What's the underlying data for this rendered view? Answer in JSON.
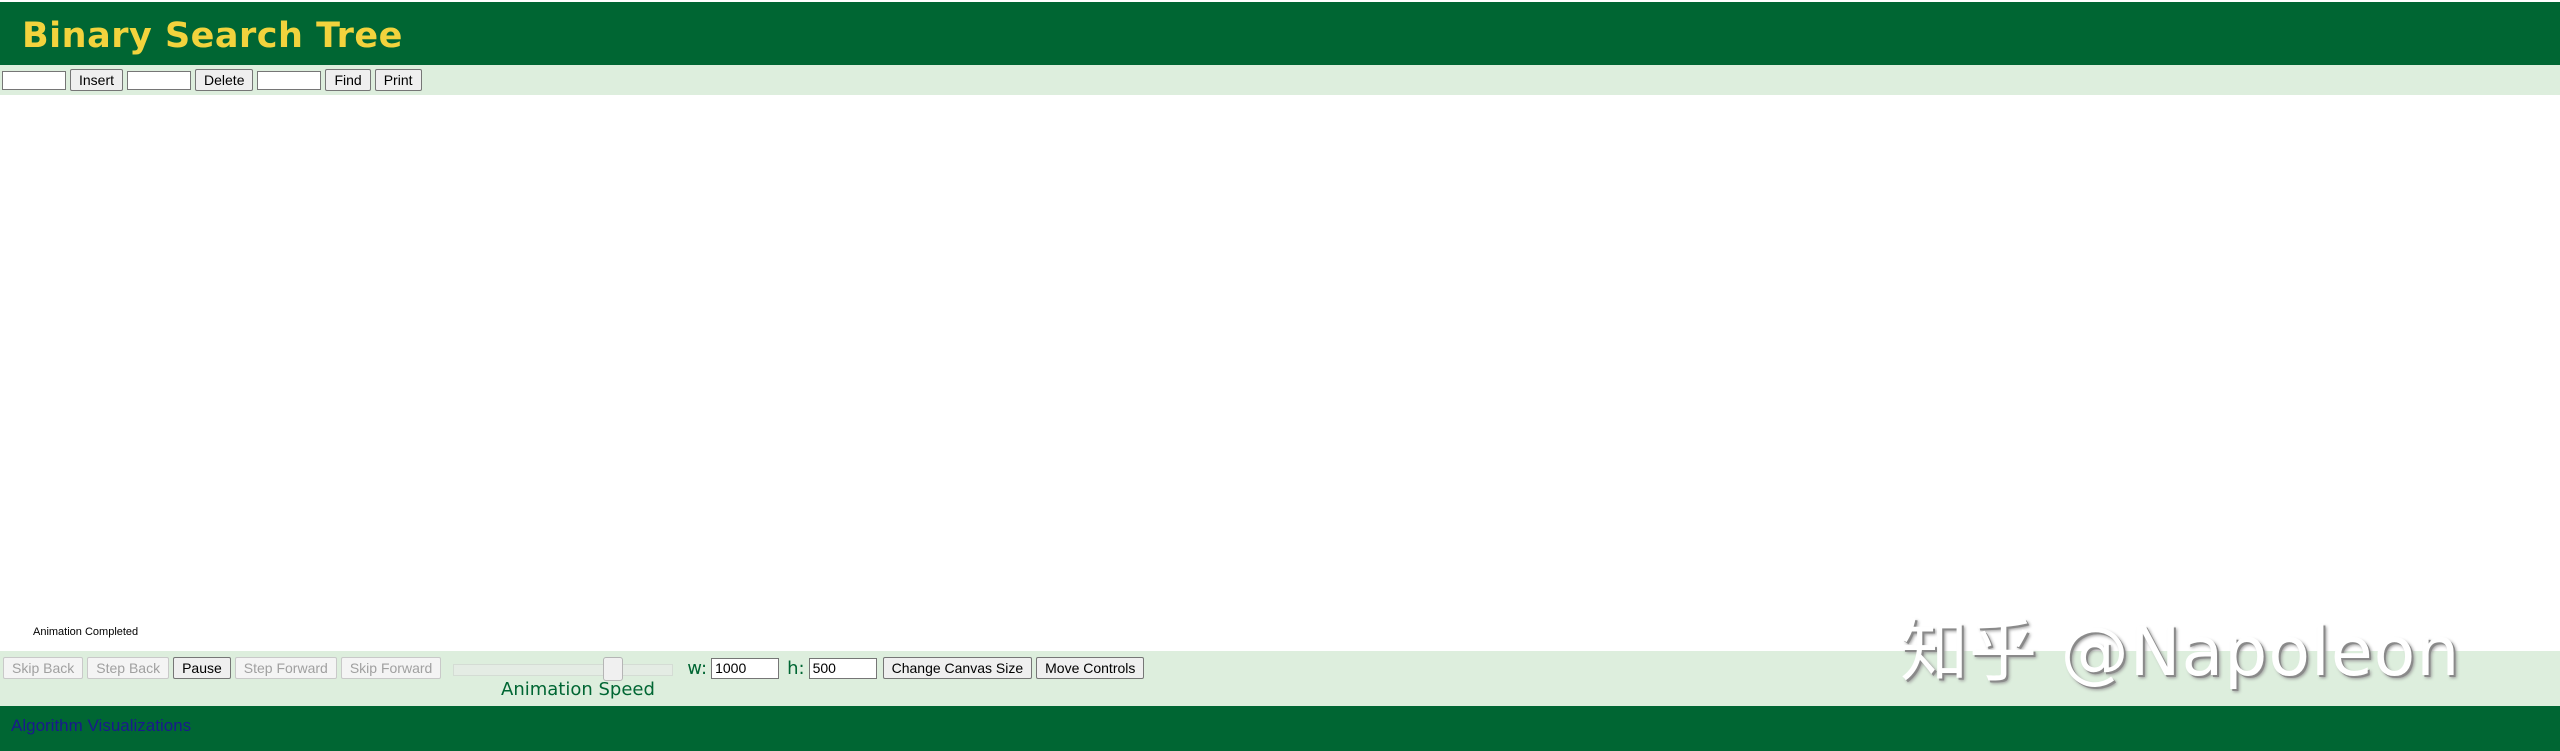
{
  "header": {
    "title": "Binary Search Tree"
  },
  "algorithm_controls": {
    "insert_value": "",
    "insert_label": "Insert",
    "delete_value": "",
    "delete_label": "Delete",
    "find_value": "",
    "find_label": "Find",
    "print_label": "Print"
  },
  "canvas": {
    "status": "Animation Completed"
  },
  "animation_controls": {
    "skip_back_label": "Skip Back",
    "step_back_label": "Step Back",
    "pause_label": "Pause",
    "step_forward_label": "Step Forward",
    "skip_forward_label": "Skip Forward",
    "speed_label": "Animation Speed",
    "speed_value": 0.75,
    "width_label": "w:",
    "width_value": "1000",
    "height_label": "h:",
    "height_value": "500",
    "change_canvas_label": "Change Canvas Size",
    "move_controls_label": "Move Controls"
  },
  "watermark": "知乎 @Napoleon",
  "footer": {
    "link_text": "Algorithm Visualizations"
  },
  "colors": {
    "header_bg": "#006633",
    "title": "#f2d33d",
    "control_bar_bg": "#ddeedd",
    "footer_link": "#1a1a8c"
  }
}
